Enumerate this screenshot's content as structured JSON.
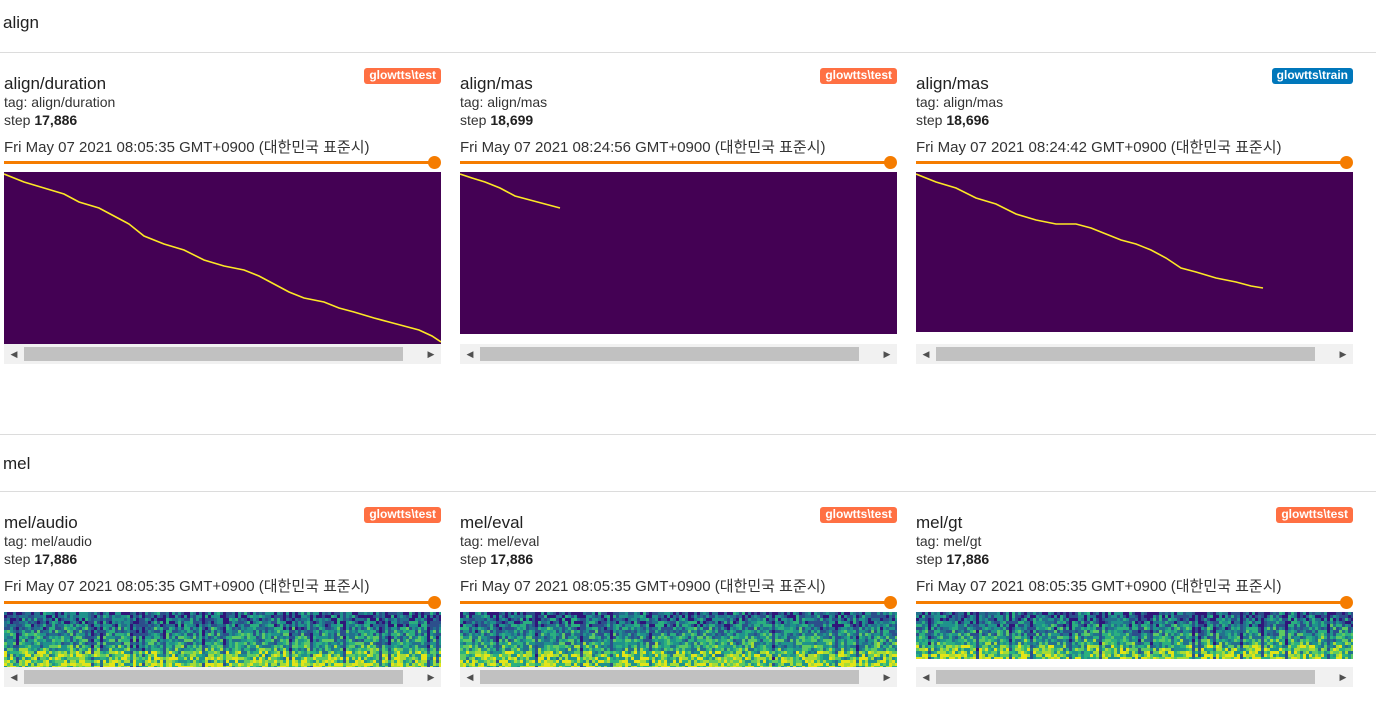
{
  "sections": [
    {
      "label": "align",
      "cards": [
        {
          "title": "align/duration",
          "run": "glowtts\\test",
          "run_color": "#ff7043",
          "tag": "tag: align/duration",
          "step_label": "step",
          "step": "17,886",
          "wall": "Fri May 07 2021 08:05:35 GMT+0900 (대한민국 표준시)"
        },
        {
          "title": "align/mas",
          "run": "glowtts\\test",
          "run_color": "#ff7043",
          "tag": "tag: align/mas",
          "step_label": "step",
          "step": "18,699",
          "wall": "Fri May 07 2021 08:24:56 GMT+0900 (대한민국 표준시)"
        },
        {
          "title": "align/mas",
          "run": "glowtts\\train",
          "run_color": "#0077bb",
          "tag": "tag: align/mas",
          "step_label": "step",
          "step": "18,696",
          "wall": "Fri May 07 2021 08:24:42 GMT+0900 (대한민국 표준시)"
        }
      ]
    },
    {
      "label": "mel",
      "cards": [
        {
          "title": "mel/audio",
          "run": "glowtts\\test",
          "run_color": "#ff7043",
          "tag": "tag: mel/audio",
          "step_label": "step",
          "step": "17,886",
          "wall": "Fri May 07 2021 08:05:35 GMT+0900 (대한민국 표준시)"
        },
        {
          "title": "mel/eval",
          "run": "glowtts\\test",
          "run_color": "#ff7043",
          "tag": "tag: mel/eval",
          "step_label": "step",
          "step": "17,886",
          "wall": "Fri May 07 2021 08:05:35 GMT+0900 (대한민국 표준시)"
        },
        {
          "title": "mel/gt",
          "run": "glowtts\\test",
          "run_color": "#ff7043",
          "tag": "tag: mel/gt",
          "step_label": "step",
          "step": "17,886",
          "wall": "Fri May 07 2021 08:05:35 GMT+0900 (대한민국 표준시)"
        }
      ]
    }
  ],
  "colors": {
    "accent": "#f57c00",
    "alignment_background": "#440154",
    "alignment_path": "#fde725"
  },
  "icons": {
    "scroll_left": "triangle-left",
    "scroll_right": "triangle-right"
  }
}
